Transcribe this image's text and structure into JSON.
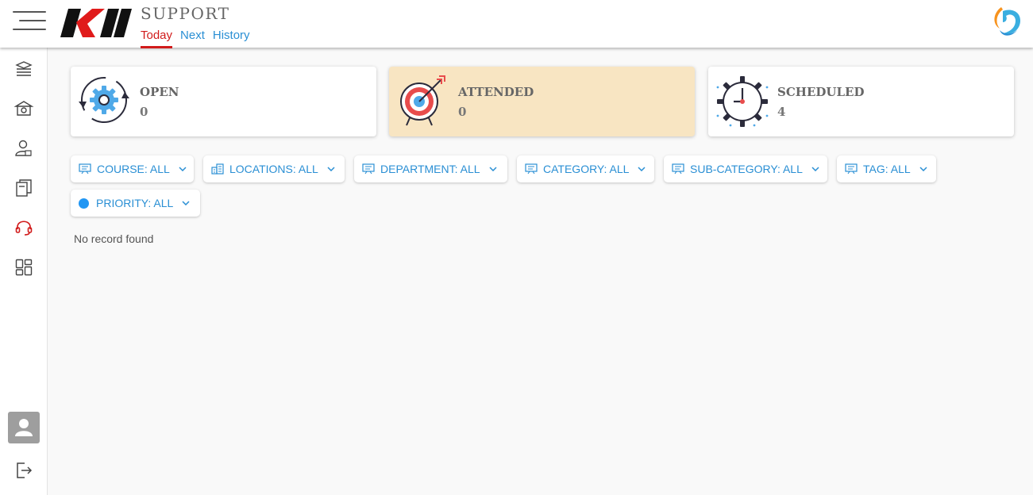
{
  "header": {
    "app_title": "SUPPORT",
    "tabs": [
      {
        "label": "Today",
        "active": true
      },
      {
        "label": "Next",
        "active": false
      },
      {
        "label": "History",
        "active": false
      }
    ]
  },
  "sidebar": {
    "items": [
      {
        "icon": "courses-icon"
      },
      {
        "icon": "institution-icon"
      },
      {
        "icon": "user-profile-icon"
      },
      {
        "icon": "library-icon"
      },
      {
        "icon": "support-headset-icon",
        "active": true
      },
      {
        "icon": "dashboard-grid-icon"
      }
    ],
    "bottom": [
      {
        "icon": "avatar"
      },
      {
        "icon": "logout-icon"
      }
    ]
  },
  "cards": [
    {
      "title": "OPEN",
      "count": "0",
      "icon": "gear-cycle-icon",
      "selected": false
    },
    {
      "title": "ATTENDED",
      "count": "0",
      "icon": "target-arrow-icon",
      "selected": true
    },
    {
      "title": "SCHEDULED",
      "count": "4",
      "icon": "clock-gear-icon",
      "selected": false
    }
  ],
  "filters": [
    {
      "label": "COURSE: ALL",
      "icon": "presentation-icon"
    },
    {
      "label": "LOCATIONS: ALL",
      "icon": "buildings-icon"
    },
    {
      "label": "DEPARTMENT: ALL",
      "icon": "presentation-icon"
    },
    {
      "label": "CATEGORY: ALL",
      "icon": "presentation-icon"
    },
    {
      "label": "SUB-CATEGORY: ALL",
      "icon": "presentation-icon"
    },
    {
      "label": "TAG: ALL",
      "icon": "presentation-icon"
    },
    {
      "label": "PRIORITY: ALL",
      "icon": "priority-dot"
    }
  ],
  "empty_message": "No record found",
  "colors": {
    "accent": "#2a8fd4",
    "active_tab": "#d11b1b",
    "selected_card": "#f8e5c2",
    "priority_dot": "#2196f3"
  }
}
